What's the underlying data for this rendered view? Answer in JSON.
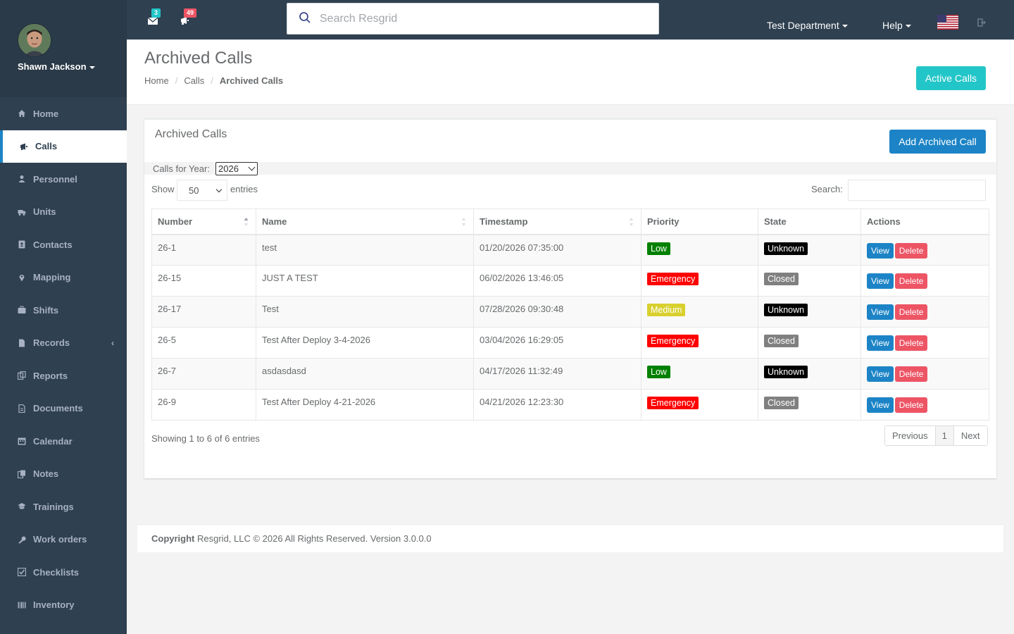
{
  "colors": {
    "sidebar_bg": "#2f4050",
    "primary": "#1c84c6",
    "info": "#23c6c8",
    "danger": "#ed5565",
    "priority_low": "#008000",
    "priority_emergency": "#ff0000",
    "priority_medium": "#d9d02f",
    "state_unknown": "#000000",
    "state_closed": "#808080"
  },
  "user": {
    "name": "Shawn Jackson"
  },
  "sidebar": {
    "items": [
      {
        "label": "Home",
        "icon": "home-icon"
      },
      {
        "label": "Calls",
        "icon": "megaphone-icon",
        "active": true
      },
      {
        "label": "Personnel",
        "icon": "user-icon"
      },
      {
        "label": "Units",
        "icon": "truck-icon"
      },
      {
        "label": "Contacts",
        "icon": "address-book-icon"
      },
      {
        "label": "Mapping",
        "icon": "map-marker-icon"
      },
      {
        "label": "Shifts",
        "icon": "briefcase-icon"
      },
      {
        "label": "Records",
        "icon": "file-icon",
        "has_children": true
      },
      {
        "label": "Reports",
        "icon": "copy-icon"
      },
      {
        "label": "Documents",
        "icon": "document-icon"
      },
      {
        "label": "Calendar",
        "icon": "calendar-icon"
      },
      {
        "label": "Notes",
        "icon": "notes-icon"
      },
      {
        "label": "Trainings",
        "icon": "graduation-icon"
      },
      {
        "label": "Work orders",
        "icon": "wrench-icon"
      },
      {
        "label": "Checklists",
        "icon": "checklist-icon"
      },
      {
        "label": "Inventory",
        "icon": "barcode-icon"
      }
    ]
  },
  "topbar": {
    "messages_count": "3",
    "alerts_count": "49",
    "search_placeholder": "Search Resgrid",
    "department": "Test Department",
    "help": "Help",
    "flag_icon": "us-flag-icon",
    "logout_icon": "sign-out-icon"
  },
  "heading": {
    "title": "Archived Calls",
    "breadcrumb": [
      "Home",
      "Calls",
      "Archived Calls"
    ],
    "active_calls_label": "Active Calls"
  },
  "panel": {
    "title": "Archived Calls",
    "add_label": "Add Archived Call",
    "year_label": "Calls for Year:",
    "year_value": "2026",
    "show_label": "Show",
    "entries_value": "50",
    "entries_label": "entries",
    "search_label": "Search:"
  },
  "table": {
    "columns": [
      "Number",
      "Name",
      "Timestamp",
      "Priority",
      "State",
      "Actions"
    ],
    "rows": [
      {
        "number": "26-1",
        "name": "test",
        "timestamp": "01/20/2026 07:35:00",
        "priority": "Low",
        "priority_color": "#008000",
        "state": "Unknown",
        "state_color": "#000000"
      },
      {
        "number": "26-15",
        "name": "JUST A TEST",
        "timestamp": "06/02/2026 13:46:05",
        "priority": "Emergency",
        "priority_color": "#ff0000",
        "state": "Closed",
        "state_color": "#808080"
      },
      {
        "number": "26-17",
        "name": "Test",
        "timestamp": "07/28/2026 09:30:48",
        "priority": "Medium",
        "priority_color": "#d9d02f",
        "state": "Unknown",
        "state_color": "#000000"
      },
      {
        "number": "26-5",
        "name": "Test After Deploy 3-4-2026",
        "timestamp": "03/04/2026 16:29:05",
        "priority": "Emergency",
        "priority_color": "#ff0000",
        "state": "Closed",
        "state_color": "#808080"
      },
      {
        "number": "26-7",
        "name": "asdasdasd",
        "timestamp": "04/17/2026 11:32:49",
        "priority": "Low",
        "priority_color": "#008000",
        "state": "Unknown",
        "state_color": "#000000"
      },
      {
        "number": "26-9",
        "name": "Test After Deploy 4-21-2026",
        "timestamp": "04/21/2026 12:23:30",
        "priority": "Emergency",
        "priority_color": "#ff0000",
        "state": "Closed",
        "state_color": "#808080"
      }
    ],
    "view_label": "View",
    "delete_label": "Delete"
  },
  "pagination": {
    "info": "Showing 1 to 6 of 6 entries",
    "previous": "Previous",
    "page": "1",
    "next": "Next"
  },
  "footer": {
    "copyright": "Copyright",
    "text": " Resgrid, LLC © 2026 All Rights Reserved.",
    "version": " Version 3.0.0.0"
  }
}
